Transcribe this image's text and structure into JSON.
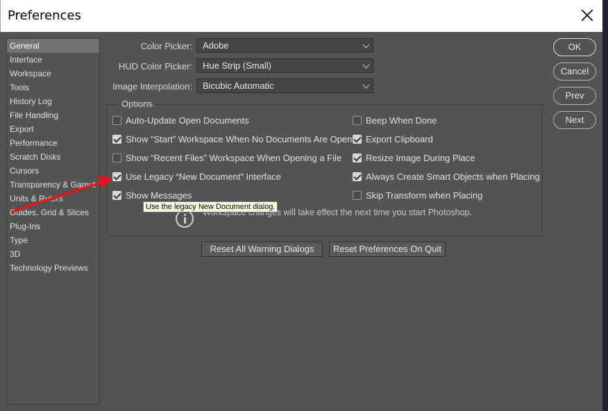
{
  "window": {
    "title": "Preferences"
  },
  "sidebar": {
    "items": [
      "General",
      "Interface",
      "Workspace",
      "Tools",
      "History Log",
      "File Handling",
      "Export",
      "Performance",
      "Scratch Disks",
      "Cursors",
      "Transparency & Gamut",
      "Units & Rulers",
      "Guides, Grid & Slices",
      "Plug-Ins",
      "Type",
      "3D",
      "Technology Previews"
    ],
    "selected": "General"
  },
  "fields": {
    "color_picker": {
      "label": "Color Picker:",
      "value": "Adobe"
    },
    "hud_color_picker": {
      "label": "HUD Color Picker:",
      "value": "Hue Strip (Small)"
    },
    "image_interpolation": {
      "label": "Image Interpolation:",
      "value": "Bicubic Automatic"
    }
  },
  "options": {
    "legend": "Options",
    "left": [
      {
        "label": "Auto-Update Open Documents",
        "checked": false
      },
      {
        "label": "Show “Start” Workspace When No Documents Are Open",
        "checked": true
      },
      {
        "label": "Show “Recent Files” Workspace When Opening a File",
        "checked": false
      },
      {
        "label": "Use Legacy “New Document” Interface",
        "checked": true
      },
      {
        "label": "Show Messages",
        "checked": true
      }
    ],
    "right": [
      {
        "label": "Beep When Done",
        "checked": false
      },
      {
        "label": "Export Clipboard",
        "checked": true
      },
      {
        "label": "Resize Image During Place",
        "checked": true
      },
      {
        "label": "Always Create Smart Objects when Placing",
        "checked": true
      },
      {
        "label": "Skip Transform when Placing",
        "checked": false
      }
    ],
    "info_text": "Workspace changes will take effect the next time you start Photoshop."
  },
  "tooltip": "Use the legacy New Document dialog.",
  "buttons": {
    "reset_warnings": "Reset All Warning Dialogs",
    "reset_prefs": "Reset Preferences On Quit",
    "ok": "OK",
    "cancel": "Cancel",
    "prev": "Prev",
    "next": "Next"
  },
  "colors": {
    "background": "#535353",
    "selected_item": "#727272",
    "annotation_arrow": "#e8141c",
    "tooltip_bg": "#ffffe1"
  }
}
